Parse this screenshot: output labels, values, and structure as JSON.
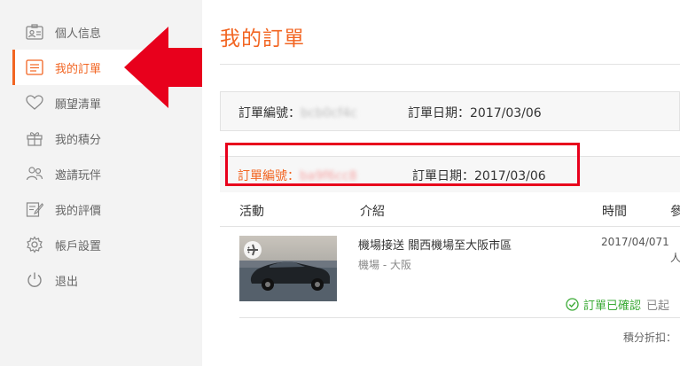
{
  "sidebar": {
    "items": [
      {
        "label": "個人信息",
        "icon": "profile-card-icon"
      },
      {
        "label": "我的訂單",
        "icon": "order-list-icon",
        "active": true
      },
      {
        "label": "願望清單",
        "icon": "heart-icon"
      },
      {
        "label": "我的積分",
        "icon": "gift-icon"
      },
      {
        "label": "邀請玩伴",
        "icon": "invite-friends-icon"
      },
      {
        "label": "我的評價",
        "icon": "review-edit-icon"
      },
      {
        "label": "帳戶設置",
        "icon": "gear-icon"
      },
      {
        "label": "退出",
        "icon": "power-icon"
      }
    ]
  },
  "main": {
    "title": "我的訂單",
    "order1": {
      "number_label": "訂單編號：",
      "number_value": "bcb0cf4c",
      "date_label": "訂單日期：",
      "date_value": "2017/03/06"
    },
    "order2": {
      "number_label": "訂單編號：",
      "number_value": "ba9f6cc8",
      "date_label": "訂單日期：",
      "date_value": "2017/03/06"
    },
    "table_headers": [
      "活動",
      "介紹",
      "時間",
      "參"
    ],
    "item": {
      "title": "機場接送 關西機場至大阪市區",
      "location": "機場 - 大阪",
      "date": "2017/04/071",
      "date_suffix": "人",
      "status": "訂單已確認",
      "status_extra": "已起",
      "points_label": "積分折扣："
    }
  },
  "colors": {
    "accent": "#f26522",
    "highlight": "#e8001c",
    "success": "#3aaa35"
  }
}
